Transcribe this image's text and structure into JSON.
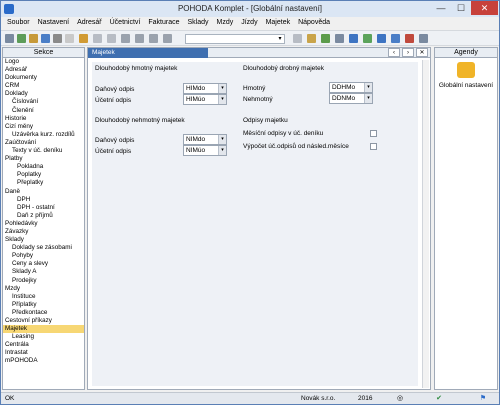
{
  "window": {
    "title": "POHODA Komplet - [Globální nastavení]"
  },
  "titlebar": {
    "minimize": "—",
    "maximize": "☐",
    "close": "✕"
  },
  "menu": [
    "Soubor",
    "Nastavení",
    "Adresář",
    "Účetnictví",
    "Fakturace",
    "Sklady",
    "Mzdy",
    "Jízdy",
    "Majetek",
    "Nápověda"
  ],
  "left_panel": {
    "header": "Sekce",
    "items": [
      {
        "label": "Logo",
        "level": 1
      },
      {
        "label": "Adresář",
        "level": 1
      },
      {
        "label": "Dokumenty",
        "level": 1
      },
      {
        "label": "CRM",
        "level": 1
      },
      {
        "label": "Doklady",
        "level": 1
      },
      {
        "label": "Číslování",
        "level": 2
      },
      {
        "label": "Členění",
        "level": 2
      },
      {
        "label": "Historie",
        "level": 1
      },
      {
        "label": "Cizí měny",
        "level": 1
      },
      {
        "label": "Uzávěrka kurz. rozdílů",
        "level": 2
      },
      {
        "label": "Zaúčtování",
        "level": 1
      },
      {
        "label": "Texty v úč. deníku",
        "level": 2
      },
      {
        "label": "Platby",
        "level": 1
      },
      {
        "label": "Pokladna",
        "level": 3
      },
      {
        "label": "Poplatky",
        "level": 3
      },
      {
        "label": "Přeplatky",
        "level": 3
      },
      {
        "label": "Daně",
        "level": 1
      },
      {
        "label": "DPH",
        "level": 3
      },
      {
        "label": "DPH - ostatní",
        "level": 3
      },
      {
        "label": "Daň z příjmů",
        "level": 3
      },
      {
        "label": "Pohledávky",
        "level": 1
      },
      {
        "label": "Závazky",
        "level": 1
      },
      {
        "label": "Sklady",
        "level": 1
      },
      {
        "label": "Doklady se zásobami",
        "level": 2
      },
      {
        "label": "Pohyby",
        "level": 2
      },
      {
        "label": "Ceny a slevy",
        "level": 2
      },
      {
        "label": "Sklady A",
        "level": 2
      },
      {
        "label": "Prodejky",
        "level": 2
      },
      {
        "label": "Mzdy",
        "level": 1
      },
      {
        "label": "Instituce",
        "level": 2
      },
      {
        "label": "Příplatky",
        "level": 2
      },
      {
        "label": "Předkontace",
        "level": 2
      },
      {
        "label": "Cestovní příkazy",
        "level": 1
      },
      {
        "label": "Majetek",
        "level": 1,
        "selected": true
      },
      {
        "label": "Leasing",
        "level": 2
      },
      {
        "label": "Centrála",
        "level": 1
      },
      {
        "label": "Intrastat",
        "level": 1
      },
      {
        "label": "mPOHODA",
        "level": 1
      }
    ]
  },
  "main": {
    "tab": "Majetek",
    "nav_prev": "‹",
    "nav_next": "›",
    "nav_close": "✕",
    "hmotny": {
      "title": "Dlouhodobý hmotný majetek",
      "danovy_label": "Daňový odpis",
      "danovy_value": "HIMdo",
      "ucetni_label": "Účetní odpis",
      "ucetni_value": "HIMúo"
    },
    "nehmotny": {
      "title": "Dlouhodobý nehmotný majetek",
      "danovy_label": "Daňový odpis",
      "danovy_value": "NIMdo",
      "ucetni_label": "Účetní odpis",
      "ucetni_value": "NIMúo"
    },
    "drobny": {
      "title": "Dlouhodobý drobný majetek",
      "hmotny_label": "Hmotný",
      "hmotny_value": "DDHMo",
      "nehmotny_label": "Nehmotný",
      "nehmotny_value": "DDNMo"
    },
    "odpisy": {
      "title": "Odpisy majetku",
      "mesicni_label": "Měsíční odpisy v úč. deníku",
      "mesicni_checked": false,
      "vypocet_label": "Výpočet úč.odpisů od násled.měsíce",
      "vypocet_checked": false
    }
  },
  "agenda": {
    "header": "Agendy",
    "item": "Globální nastavení"
  },
  "status": {
    "left": "OK",
    "company": "Novák s.r.o.",
    "year": "2016"
  }
}
